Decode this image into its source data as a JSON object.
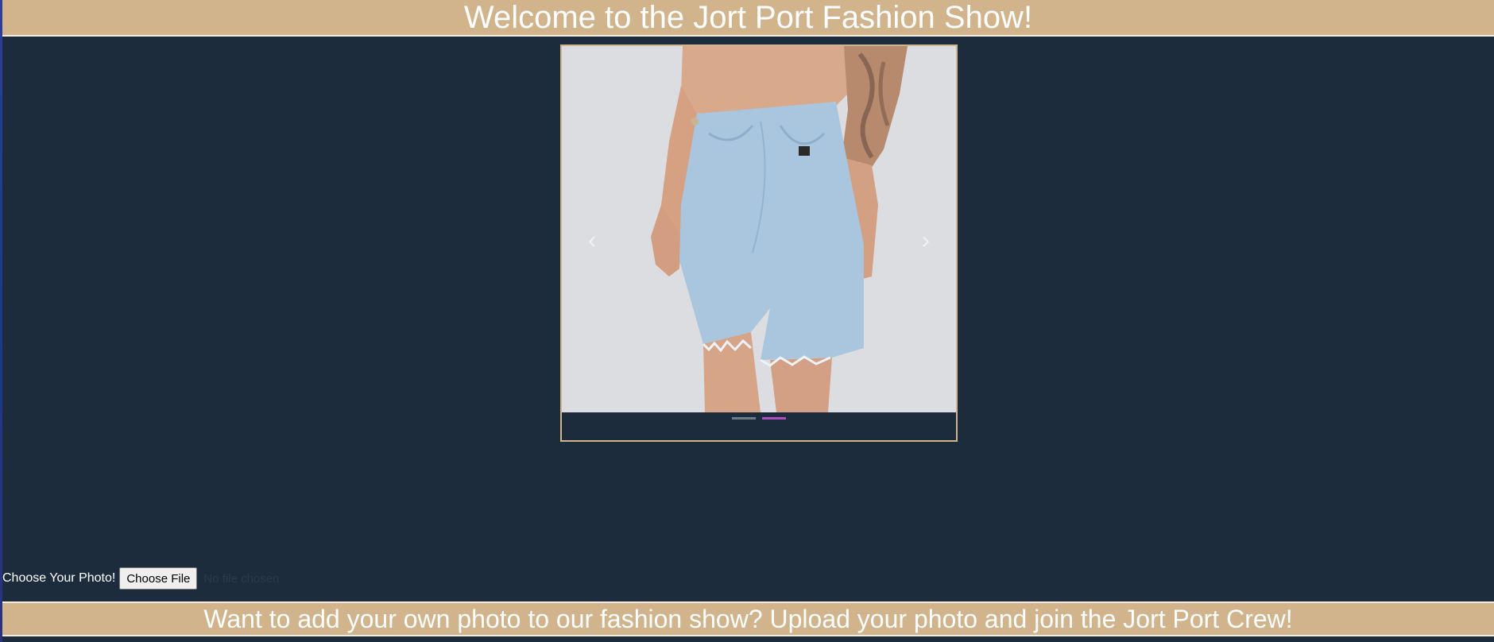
{
  "header": {
    "title": "Welcome to the Jort Port Fashion Show!"
  },
  "carousel": {
    "prev_icon": "chevron-left-icon",
    "next_icon": "chevron-right-icon",
    "prev_glyph": "‹",
    "next_glyph": "›",
    "slide_count": 2,
    "active_slide": 2,
    "colors": {
      "background": "#dcdde0",
      "indicator": "#6d7d8a",
      "indicator_active": "#b04fc2"
    }
  },
  "upload": {
    "label": "Choose Your Photo!",
    "button_label": "Choose File",
    "status": "No file chosen"
  },
  "footer": {
    "text": "Want to add your own photo to our fashion show? Upload your photo and join the Jort Port Crew!"
  },
  "colors": {
    "page_bg": "#1c2c3c",
    "banner_bg": "#d1b48b",
    "banner_text": "#ffffff"
  }
}
